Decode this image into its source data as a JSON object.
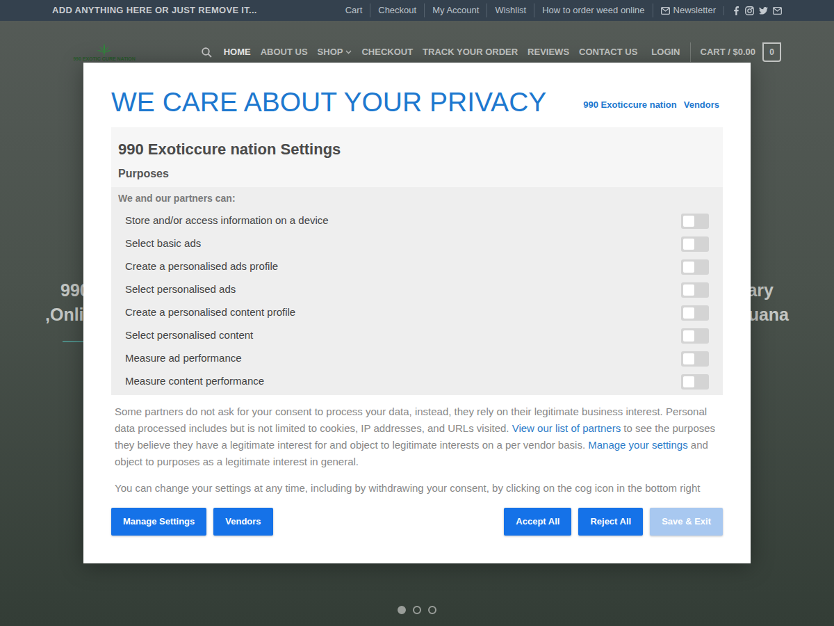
{
  "topbar": {
    "announcement": "ADD ANYTHING HERE OR JUST REMOVE IT...",
    "links": [
      "Cart",
      "Checkout",
      "My Account",
      "Wishlist",
      "How to order weed online"
    ],
    "newsletter": "Newsletter"
  },
  "header": {
    "logo": "990 EXOTIC CURE NATION",
    "nav": [
      {
        "label": "HOME",
        "selected": true,
        "dropdown": false
      },
      {
        "label": "ABOUT US",
        "selected": false,
        "dropdown": false
      },
      {
        "label": "SHOP",
        "selected": false,
        "dropdown": true
      },
      {
        "label": "CHECKOUT",
        "selected": false,
        "dropdown": false
      },
      {
        "label": "TRACK YOUR ORDER",
        "selected": false,
        "dropdown": false
      },
      {
        "label": "REVIEWS",
        "selected": false,
        "dropdown": false
      },
      {
        "label": "CONTACT US",
        "selected": false,
        "dropdown": false
      }
    ],
    "login": "LOGIN",
    "cart": {
      "label": "CART / $0.00",
      "count": "0"
    }
  },
  "hero": {
    "lines": [
      {
        "left": "990",
        "right": "ary"
      },
      {
        "left": ",Onli",
        "right": "uana"
      }
    ]
  },
  "slider": {
    "dots": [
      {
        "selected": true
      },
      {
        "selected": false
      },
      {
        "selected": false
      }
    ]
  },
  "modal": {
    "title": "WE CARE ABOUT YOUR PRIVACY",
    "tabs": [
      "990 Exoticcure nation",
      "Vendors"
    ],
    "settings_title": "990 Exoticcure nation Settings",
    "section": "Purposes",
    "list_heading": "We and our partners can:",
    "purposes": [
      {
        "label": "Store and/or access information on a device",
        "on": false
      },
      {
        "label": "Select basic ads",
        "on": false
      },
      {
        "label": "Create a personalised ads profile",
        "on": false
      },
      {
        "label": "Select personalised ads",
        "on": false
      },
      {
        "label": "Create a personalised content profile",
        "on": false
      },
      {
        "label": "Select personalised content",
        "on": false
      },
      {
        "label": "Measure ad performance",
        "on": false
      },
      {
        "label": "Measure content performance",
        "on": false
      }
    ],
    "notice": [
      {
        "text": "Some partners do not ask for your consent to process your data, instead, they rely on their legitimate business interest. Personal data processed includes but is not limited to cookies, IP addresses, and URLs visited. ",
        "link": false
      },
      {
        "text": "View our list of partners",
        "link": true
      },
      {
        "text": " to see the purposes they believe they have a legitimate interest for and object to legitimate interests on a per vendor basis. ",
        "link": false
      },
      {
        "text": "Manage your settings",
        "link": true
      },
      {
        "text": " and object to purposes as a legitimate interest in general.",
        "link": false
      }
    ],
    "notice2": "You can change your settings at any time, including by withdrawing your consent, by clicking on the cog icon in the bottom right",
    "buttons_left": [
      {
        "label": "Manage Settings",
        "disabled": false
      },
      {
        "label": "Vendors",
        "disabled": false
      }
    ],
    "buttons_right": [
      {
        "label": "Accept All",
        "disabled": false
      },
      {
        "label": "Reject All",
        "disabled": false
      },
      {
        "label": "Save & Exit",
        "disabled": true
      }
    ]
  }
}
